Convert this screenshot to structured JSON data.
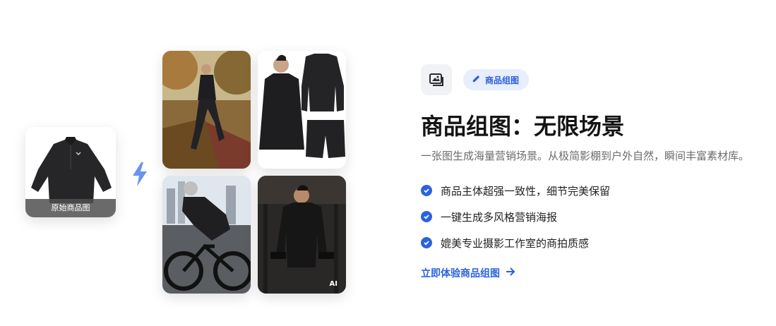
{
  "original_card": {
    "caption": "原始商品图"
  },
  "gallery": {
    "ai_tag": "AI"
  },
  "badge": {
    "label": "商品组图",
    "icon": "pencil-icon"
  },
  "header_icon": "image-gallery-icon",
  "title": "商品组图：无限场景",
  "subtitle": "一张图生成海量营销场景。从极简影棚到户外自然，瞬间丰富素材库。",
  "features": [
    "商品主体超强一致性，细节完美保留",
    "一键生成多风格营销海报",
    "媲美专业摄影工作室的商拍质感"
  ],
  "cta": {
    "label": "立即体验商品组图",
    "icon": "arrow-right-icon"
  },
  "colors": {
    "accent": "#2c62dc",
    "badge_bg": "#e7eefc",
    "title": "#141414",
    "subtitle": "#6b6b6b"
  }
}
